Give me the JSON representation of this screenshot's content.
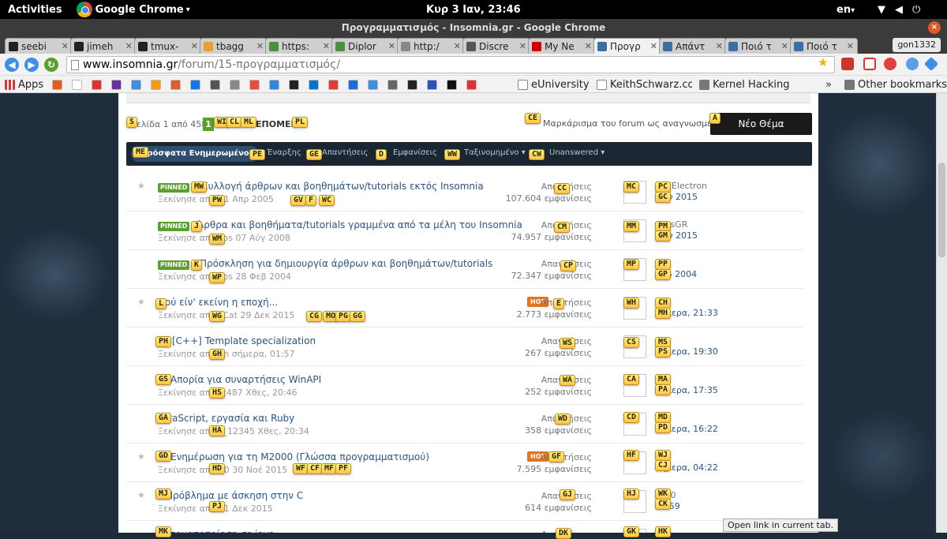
{
  "os": {
    "activities": "Activities",
    "app_name": "Google Chrome",
    "clock": "Κυρ  3 Ιαν, 23:46",
    "lang": "en"
  },
  "window": {
    "title": "Προγραμματισμός - Insomnia.gr - Google Chrome",
    "close": "×"
  },
  "tabs": [
    {
      "label": "seebi",
      "color": "#222"
    },
    {
      "label": "jimeh",
      "color": "#222"
    },
    {
      "label": "tmux-",
      "color": "#222"
    },
    {
      "label": "tbagg",
      "color": "#e8a030"
    },
    {
      "label": "https:",
      "color": "#4a8f3c"
    },
    {
      "label": "Diplor",
      "color": "#4a8f3c"
    },
    {
      "label": "http:/",
      "color": "#888"
    },
    {
      "label": "Discre",
      "color": "#555"
    },
    {
      "label": "My Ne",
      "color": "#cc0000"
    },
    {
      "label": "Προγρ",
      "color": "#3a6ea5"
    },
    {
      "label": "Απάντ",
      "color": "#3a6ea5"
    },
    {
      "label": "Ποιό τ",
      "color": "#3a6ea5"
    },
    {
      "label": "Ποιό τ",
      "color": "#3a6ea5"
    }
  ],
  "user_button": "gon1332",
  "url": {
    "domain": "www.insomnia.gr",
    "path": "/forum/15-προγραμματισμός/"
  },
  "bookmarks": {
    "apps": "Apps",
    "items": [
      "eUniversity",
      "KeithSchwarz.com",
      "Kernel Hacking"
    ],
    "more": "»",
    "other": "Other bookmarks"
  },
  "pager": {
    "text": "Σελίδα 1 από 458",
    "current": "1",
    "next": "ΕΠΟΜΕΝΟ"
  },
  "mark_read": "Μαρκάρισμα του forum ως αναγνωσμένο",
  "new_topic": "Νέο Θέμα",
  "filters": {
    "recent": "Πρόσφατα Ενημερωμένο",
    "start": "Έναρξης",
    "replies": "Απαντήσεις",
    "views": "Εμφανίσεις",
    "sort": "Ταξινομημένο",
    "answered": "Unanswered"
  },
  "topics": [
    {
      "pinned": "PINNED",
      "title": "Συλλογή άρθρων και βοηθημάτων/tutorials εκτός Insomnia",
      "started": "Ξεκίνησε από",
      "starter_date": "11 Απρ 2005",
      "stat1": "Απαντήσεις",
      "stat2": "107.604 εμφανίσεις",
      "lp1": "RedElectron",
      "lp2": "Ιούν 2015"
    },
    {
      "pinned": "PINNED",
      "title": "Άρθρα και βοηθήματα/tutorials γραμμένα από τα μέλη του Insomnia",
      "started": "Ξεκίνησε από",
      "starter_date": "sos 07 Αύγ 2008",
      "stat1": "Απαντήσεις",
      "stat2": "74.957 εμφανίσεις",
      "lp1": "akosGR",
      "lp2": "Ιούν 2015"
    },
    {
      "pinned": "PINNED",
      "title": "Πρόσκληση για δημιουργία άρθρων και βοηθημάτων/tutorials",
      "started": "Ξεκίνησε από",
      "starter_date": "sos 28 Φεβ 2004",
      "stat1": "Απαντήσεις",
      "stat2": "72.347 εμφανίσεις",
      "lp1": "sos",
      "lp2": "Φεβ 2004"
    },
    {
      "pinned": "",
      "title": "Πού είν' εκείνη η εποχή...",
      "started": "Ξεκίνησε από",
      "starter_date": "_Cat 29 Δεκ 2015",
      "hot": "HOT",
      "stat1": "Απαντήσεις",
      "stat2": "2.773 εμφανίσεις",
      "lp1": "cer",
      "lp2": "σήμερα, 21:33"
    },
    {
      "pinned": "",
      "title": "[C++] Template specialization",
      "started": "Ξεκίνησε από",
      "starter_date": "yn σήμερα, 01:57",
      "stat1": "Απαντήσεις",
      "stat2": "267 εμφανίσεις",
      "lp1": "00",
      "lp2": "σήμερα, 19:30"
    },
    {
      "pinned": "",
      "title": "Απορία για συναρτήσεις WinAPI",
      "started": "Ξεκίνησε από",
      "starter_date": "st487 Χθες, 20:46",
      "stat1": "Απαντήσεις",
      "stat2": "252 εμφανίσεις",
      "lp1": "00",
      "lp2": "σήμερα, 17:35"
    },
    {
      "pinned": "",
      "title": "JavaScript, εργασία και Ruby",
      "started": "Ξεκίνησε από",
      "starter_date": "s_12345 Χθες, 20:34",
      "stat1": "Απαντήσεις",
      "stat2": "358 εμφανίσεις",
      "lp1": "00",
      "lp2": "σήμερα, 16:22"
    },
    {
      "pinned": "",
      "title": "Ενημέρωση για τη Μ2000 (Γλώσσα προγραμματισμού)",
      "started": "Ξεκίνησε από",
      "starter_date": "00 30 Νοέ 2015",
      "hot": "HOT",
      "stat1": "Απαντήσεις",
      "stat2": "7.595 εμφανίσεις",
      "lp1": "00",
      "lp2": "σήμερα, 04:22"
    },
    {
      "pinned": "",
      "title": "Πρόβλημα με άσκηση στην C",
      "started": "Ξεκίνησε από",
      "starter_date": "31 Δεκ 2015",
      "stat1": "Απαντήσεις",
      "stat2": "614 εμφανίσεις",
      "lp1": "os10",
      "lp2": "23:59"
    },
    {
      "pinned": "",
      "title": "Αυτοματοποίηση σε java",
      "started": "",
      "starter_date": "",
      "stat1": "Απαντήσεις",
      "stat2": "",
      "lp1": "",
      "lp2": ""
    }
  ],
  "hints": [
    "S",
    "WI",
    "CL",
    "ML",
    "PL",
    "CE",
    "A",
    "ME",
    "PE",
    "GE",
    "D",
    "WW",
    "CW",
    "MW",
    "PW",
    "GV",
    "F",
    "WC",
    "CC",
    "MC",
    "PC",
    "GC",
    "J",
    "WM",
    "CM",
    "MM",
    "PM",
    "GM",
    "K",
    "WP",
    "CP",
    "MP",
    "PP",
    "GP",
    "L",
    "WG",
    "CG",
    "MO",
    "PG",
    "GG",
    "E",
    "WH",
    "CH",
    "MH",
    "PH",
    "GH",
    "WS",
    "CS",
    "MS",
    "PS",
    "GS",
    "HS",
    "WA",
    "CA",
    "MA",
    "PA",
    "GA",
    "HA",
    "WD",
    "CD",
    "MD",
    "PD",
    "GD",
    "HD",
    "WF",
    "CF",
    "MF",
    "PF",
    "GF",
    "HF",
    "WJ",
    "CJ",
    "MJ",
    "PJ",
    "GJ",
    "HJ",
    "WK",
    "CK",
    "MK",
    "DK",
    "GK",
    "HK"
  ],
  "status_bar": "Open link in current tab.",
  "colors": {
    "accent": "#5aa02c",
    "hot": "#e27520",
    "header": "#1b2633"
  }
}
